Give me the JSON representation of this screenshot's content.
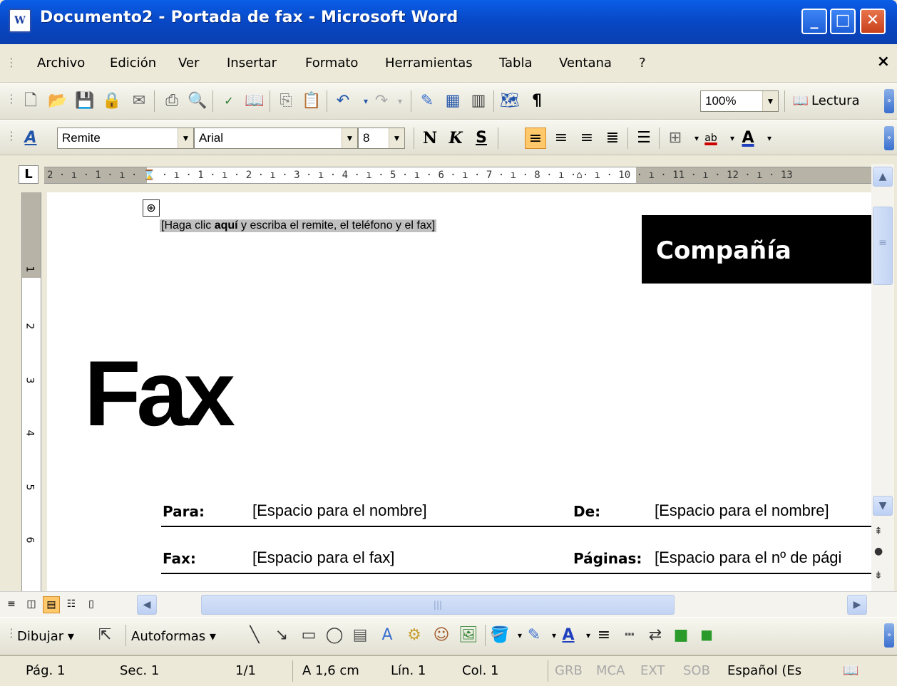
{
  "window": {
    "title": "Documento2 - Portada de fax - Microsoft Word",
    "app_icon_letter": "W",
    "minimize_glyph": "_",
    "maximize_glyph": "□",
    "close_glyph": "✕"
  },
  "menu": {
    "items": [
      "Archivo",
      "Edición",
      "Ver",
      "Insertar",
      "Formato",
      "Herramientas",
      "Tabla",
      "Ventana",
      "?"
    ],
    "doc_close": "×"
  },
  "standard_toolbar": {
    "zoom": "100%",
    "reading_label": "Lectura",
    "icons": [
      "new-icon",
      "open-icon",
      "save-icon",
      "permission-icon",
      "email-icon",
      "print-icon",
      "print-preview-icon",
      "spelling-icon",
      "research-icon",
      "copy-icon",
      "paste-icon",
      "undo-icon",
      "redo-icon",
      "insert-hyperlink-icon",
      "table-icon",
      "columns-icon",
      "document-map-icon",
      "show-formatting-icon"
    ],
    "pilcrow": "¶"
  },
  "format_toolbar": {
    "style": "Remite",
    "font": "Arial",
    "size": "8",
    "bold": "N",
    "italic": "K",
    "underline": "S",
    "highlight_label": "ab",
    "font_color_label": "A"
  },
  "ruler": {
    "tab_selector": "L",
    "scale_text": "2 · ı · 1 · ı · ⌛ · ı · 1 · ı · 2 · ı · 3 · ı · 4 · ı · 5 · ı · 6 · ı · 7 · ı · 8 · ı ·⌂· ı · 10 · ı · 11 · ı · 12 · ı · 13",
    "vertical_numbers": [
      "1",
      "2",
      "3",
      "4",
      "5",
      "6"
    ]
  },
  "document": {
    "move_handle": "⊕",
    "sender_placeholder_pre": "[Haga clic ",
    "sender_placeholder_bold": "aquí",
    "sender_placeholder_post": " y escriba el remite, el teléfono y el fax]",
    "company": "Compañía",
    "fax_title": "Fax",
    "fields": {
      "para_label": "Para:",
      "para_value": "[Espacio para el nombre]",
      "de_label": "De:",
      "de_value": "[Espacio para el nombre]",
      "fax_label": "Fax:",
      "fax_value": "[Espacio para el fax]",
      "paginas_label": "Páginas:",
      "paginas_value": "[Espacio para el nº de pági"
    }
  },
  "drawing_toolbar": {
    "draw_label": "Dibujar ▾",
    "autoshapes_label": "Autoformas ▾"
  },
  "status": {
    "page": "Pág. 1",
    "section": "Sec. 1",
    "pages": "1/1",
    "at": "A 1,6 cm",
    "line": "Lín. 1",
    "col": "Col. 1",
    "grb": "GRB",
    "mca": "MCA",
    "ext": "EXT",
    "sob": "SOB",
    "language": "Español (Es"
  },
  "colors": {
    "title_bar": "#0a5ee8",
    "chrome": "#ece9d8",
    "company_box": "#000000",
    "highlight": "#c0c0c0"
  }
}
